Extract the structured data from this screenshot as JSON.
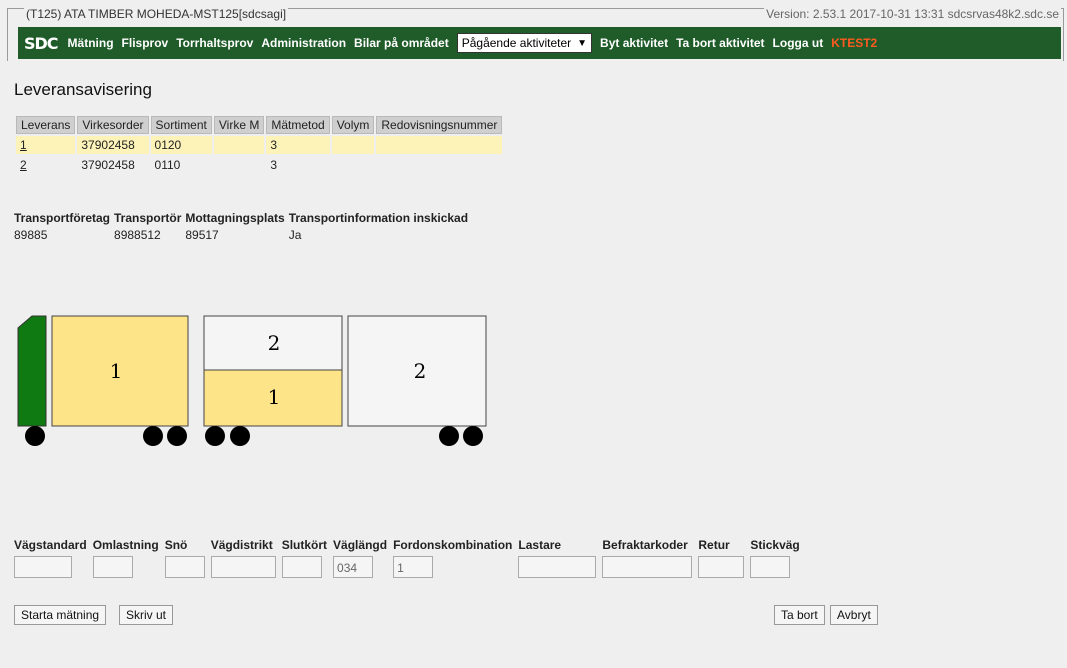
{
  "header": {
    "title": "(T125) ATA TIMBER MOHEDA-MST125[sdcsagi]",
    "version": "Version: 2.53.1  2017-10-31 13:31  sdcsrvas48k2.sdc.se"
  },
  "nav": {
    "logo": "SDC",
    "items": [
      "Mätning",
      "Flisprov",
      "Torrhaltsprov",
      "Administration",
      "Bilar på området"
    ],
    "activity_select": "Pågående aktiviteter",
    "actions": [
      "Byt aktivitet",
      "Ta bort aktivitet",
      "Logga ut"
    ],
    "user": "KTEST2"
  },
  "page_title": "Leveransavisering",
  "leverans_table": {
    "headers": [
      "Leverans",
      "Virkesorder",
      "Sortiment",
      "Virke M",
      "Mätmetod",
      "Volym",
      "Redovisningsnummer"
    ],
    "rows": [
      {
        "leverans": "1",
        "virkesorder": "37902458",
        "sortiment": "0120",
        "virke_m": "",
        "matmetod": "3",
        "volym": "",
        "redovisningsnummer": ""
      },
      {
        "leverans": "2",
        "virkesorder": "37902458",
        "sortiment": "0110",
        "virke_m": "",
        "matmetod": "3",
        "volym": "",
        "redovisningsnummer": ""
      }
    ]
  },
  "transport": {
    "headers": [
      "Transportföretag",
      "Transportör",
      "Mottagningsplats",
      "Transportinformation inskickad"
    ],
    "values": [
      "89885",
      "8988512",
      "89517",
      "Ja"
    ]
  },
  "truck": {
    "cab_color": "#0f7a12",
    "load_color": "#fde489",
    "empty_color": "#f5f5f5",
    "truck_load": "1",
    "trailer1_top": "2",
    "trailer1_bottom": "1",
    "trailer2": "2"
  },
  "form": {
    "labels": [
      "Vägstandard",
      "Omlastning",
      "Snö",
      "Vägdistrikt",
      "Slutkört",
      "Väglängd",
      "Fordonskombination",
      "Lastare",
      "Befraktarkoder",
      "Retur",
      "Stickväg"
    ],
    "values": [
      "",
      "",
      "",
      "",
      "",
      "034",
      "1",
      "",
      "",
      "",
      ""
    ]
  },
  "buttons": {
    "start": "Starta mätning",
    "print": "Skriv ut",
    "delete": "Ta bort",
    "cancel": "Avbryt"
  }
}
